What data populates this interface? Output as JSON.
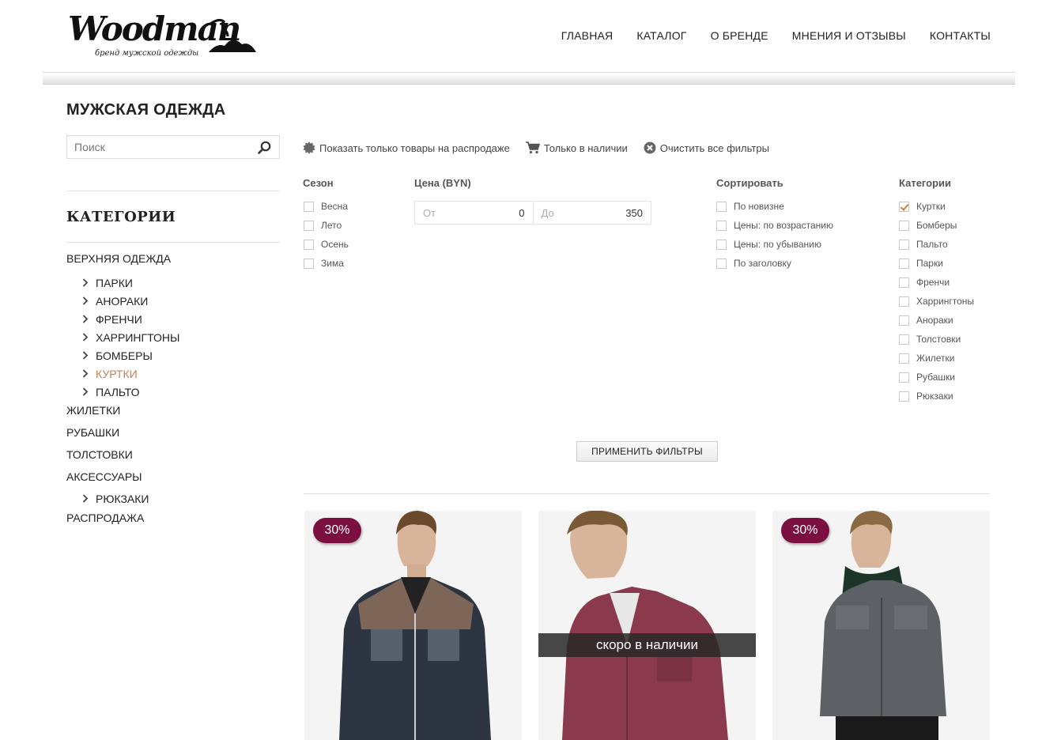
{
  "brand": {
    "name": "Woodman",
    "tagline": "бренд мужской одежды"
  },
  "nav": [
    "ГЛАВНАЯ",
    "КАТАЛОГ",
    "О БРЕНДЕ",
    "МНЕНИЯ И ОТЗЫВЫ",
    "КОНТАКТЫ"
  ],
  "page_title": "МУЖСКАЯ ОДЕЖДА",
  "search": {
    "placeholder": "Поиск",
    "value": ""
  },
  "categories": {
    "title": "КАТЕГОРИИ",
    "outerwear": {
      "label": "ВЕРХНЯЯ ОДЕЖДА",
      "items": [
        "ПАРКИ",
        "АНОРАКИ",
        "ФРЕНЧИ",
        "ХАРРИНГТОНЫ",
        "БОМБЕРЫ",
        "КУРТКИ",
        "ПАЛЬТО"
      ],
      "active": "КУРТКИ"
    },
    "vests": "ЖИЛЕТКИ",
    "shirts": "РУБАШКИ",
    "hoodies": "ТОЛСТОВКИ",
    "accessories": {
      "label": "АКСЕССУАРЫ",
      "items": [
        "РЮКЗАКИ"
      ]
    },
    "sale": "РАСПРОДАЖА"
  },
  "quick_filters": {
    "sale_only": "Показать только товары на распродаже",
    "in_stock": "Только в наличии",
    "clear_all": "Очистить все фильтры"
  },
  "filters": {
    "season": {
      "title": "Сезон",
      "options": [
        "Весна",
        "Лето",
        "Осень",
        "Зима"
      ]
    },
    "price": {
      "title": "Цена (BYN)",
      "from_label": "От",
      "from_value": "0",
      "to_label": "До",
      "to_value": "350"
    },
    "sort": {
      "title": "Сортировать",
      "options": [
        "По новизне",
        "Цены: по возрастанию",
        "Цены: по убыванию",
        "По заголовку"
      ]
    },
    "category": {
      "title": "Категории",
      "options": [
        "Куртки",
        "Бомберы",
        "Пальто",
        "Парки",
        "Френчи",
        "Харрингтоны",
        "Анораки",
        "Толстовки",
        "Жилетки",
        "Рубашки",
        "Рюкзаки"
      ],
      "checked": "Куртки"
    },
    "apply_label": "ПРИМЕНИТЬ ФИЛЬТРЫ"
  },
  "products": [
    {
      "badge": "30%",
      "overlay": "",
      "jacket_color": "#2c3541",
      "yoke_color": "#7d6558"
    },
    {
      "badge": "",
      "overlay": "скоро в наличии",
      "jacket_color": "#8a3a4c",
      "yoke_color": "#8a3a4c"
    },
    {
      "badge": "30%",
      "overlay": "",
      "jacket_color": "#5d6064",
      "yoke_color": "#5d6064"
    }
  ],
  "colors": {
    "accent": "#c8804d",
    "badge": "#7b1040"
  }
}
